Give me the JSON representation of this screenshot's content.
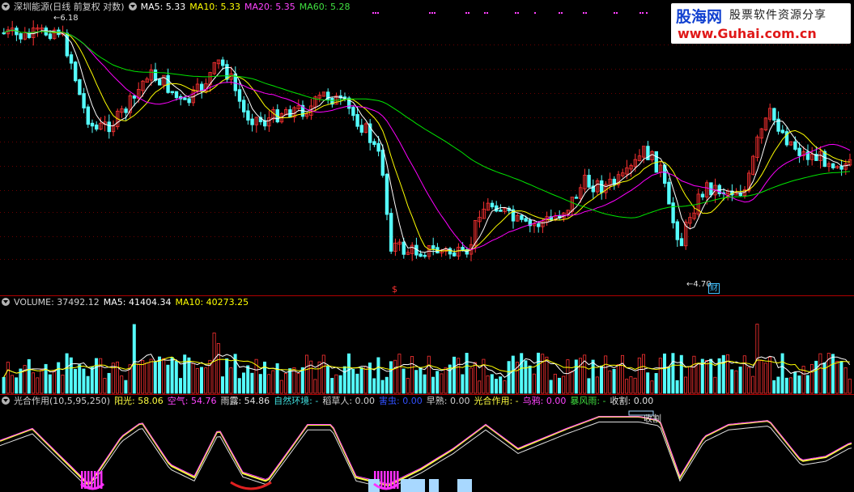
{
  "main_header": {
    "stock": "深圳能源(日线 前复权 对数)",
    "ma5": "MA5: 5.33",
    "ma10": "MA10: 5.33",
    "ma20": "MA20: 5.35",
    "ma60": "MA60: 5.28"
  },
  "volume_header": {
    "volume": "VOLUME: 37492.12",
    "ma5": "MA5: 41404.34",
    "ma10": "MA10: 40273.25"
  },
  "indicator_header": {
    "name": "光合作用(10,5,95,250)",
    "sun": "阳光: 58.06",
    "air": "空气: 54.76",
    "rain": "雨露: 54.86",
    "env": "自然环境: -",
    "scarecrow": "稻草人: 0.00",
    "pest": "害虫: 0.00",
    "early": "早熟: 0.00",
    "photo": "光合作用: -",
    "crow": "乌鸦: 0.00",
    "storm": "暴风雨: -",
    "harvest": "收割: 0.00"
  },
  "annotations": {
    "high_price": "6.18",
    "low_price": "4.70",
    "cai": "财",
    "harvest_tag": "收割"
  },
  "logo": {
    "brand": "股海网",
    "slogan": "股票软件资源分享",
    "url": "www.Guhai.com.cn"
  },
  "colors": {
    "up": "#ff3232",
    "down": "#54fcfc",
    "ma5": "#ffffff",
    "ma10": "#ffff00",
    "ma20": "#ff00ff",
    "ma60": "#00e600",
    "sun": "#ffff40",
    "air": "#ff40ff",
    "rain": "#e0e0e0"
  }
}
